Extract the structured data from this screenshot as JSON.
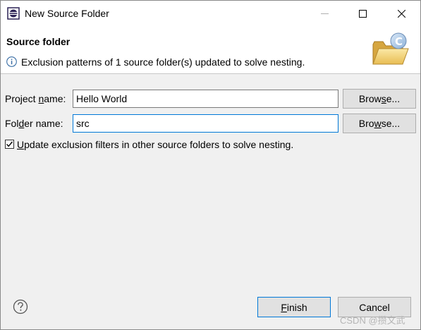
{
  "window": {
    "title": "New Source Folder"
  },
  "header": {
    "title": "Source folder",
    "message": "Exclusion patterns of 1 source folder(s) updated to solve nesting."
  },
  "form": {
    "project_label_pre": "Project ",
    "project_label_mn": "n",
    "project_label_post": "ame:",
    "project_value": "Hello World",
    "folder_label_pre": "Fol",
    "folder_label_mn": "d",
    "folder_label_post": "er name:",
    "folder_value": "src",
    "browse_pre": "Brow",
    "browse_mn1": "s",
    "browse_mn2": "w",
    "browse_post": "e...",
    "browse2_pre": "Bro",
    "browse2_mn": "w",
    "browse2_post": "se...",
    "checkbox_mn": "U",
    "checkbox_label_rest": "pdate exclusion filters in other source folders to solve nesting.",
    "checkbox_checked": true
  },
  "footer": {
    "finish_mn": "F",
    "finish_rest": "inish",
    "cancel_label": "Cancel",
    "watermark": "CSDN @攒文武"
  },
  "colors": {
    "focus": "#0078d7",
    "button_bg": "#e1e1e1",
    "header_bg": "#ffffff"
  }
}
